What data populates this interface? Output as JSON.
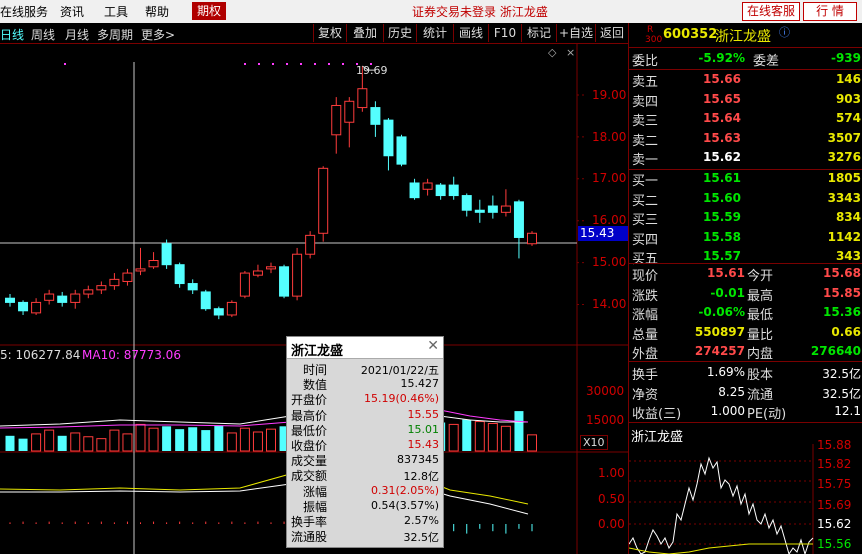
{
  "menubar": {
    "items": [
      "在线服务",
      "资讯",
      "工具",
      "帮助"
    ],
    "options_tab": "期权",
    "status_text": "证券交易未登录  浙江龙盛",
    "online_service_button": "在线客服",
    "quote_button": "行 情"
  },
  "toolbar": {
    "periods": [
      "日线",
      "周线",
      "月线",
      "多周期",
      "更多>"
    ],
    "buttons": [
      "复权",
      "叠加",
      "历史",
      "统计",
      "画线",
      "F10",
      "标记",
      "+自选",
      "返回"
    ]
  },
  "chart": {
    "max_price_label": "19.69",
    "crosshair_price": "15.43",
    "price_axis": [
      "19.00",
      "18.00",
      "17.00",
      "16.00",
      "15.00",
      "14.00"
    ],
    "vol_ma_text": "5: 106277.84",
    "vol_ma10_text": "MA10: 87773.06",
    "vol_axis": [
      "30000",
      "15000"
    ],
    "vol_unit": "X10",
    "macd_axis": [
      "1.00",
      "0.50",
      "0.00"
    ]
  },
  "chart_data": {
    "type": "candlestick",
    "up_color": "#ff3c3c",
    "down_color": "#54ffff",
    "candles": [
      {
        "o": 14.15,
        "c": 14.05,
        "h": 14.25,
        "l": 13.95
      },
      {
        "o": 14.05,
        "c": 13.85,
        "h": 14.1,
        "l": 13.75
      },
      {
        "o": 13.8,
        "c": 14.05,
        "h": 14.15,
        "l": 13.75
      },
      {
        "o": 14.1,
        "c": 14.25,
        "h": 14.35,
        "l": 14.0
      },
      {
        "o": 14.2,
        "c": 14.05,
        "h": 14.3,
        "l": 13.95
      },
      {
        "o": 14.05,
        "c": 14.25,
        "h": 14.35,
        "l": 13.9
      },
      {
        "o": 14.25,
        "c": 14.35,
        "h": 14.45,
        "l": 14.15
      },
      {
        "o": 14.35,
        "c": 14.45,
        "h": 14.55,
        "l": 14.25
      },
      {
        "o": 14.45,
        "c": 14.6,
        "h": 14.75,
        "l": 14.35
      },
      {
        "o": 14.55,
        "c": 14.75,
        "h": 14.85,
        "l": 14.45
      },
      {
        "o": 14.8,
        "c": 14.85,
        "h": 15.35,
        "l": 14.7
      },
      {
        "o": 14.9,
        "c": 15.05,
        "h": 15.25,
        "l": 14.85
      },
      {
        "o": 15.45,
        "c": 14.95,
        "h": 15.55,
        "l": 14.85
      },
      {
        "o": 14.95,
        "c": 14.5,
        "h": 15.0,
        "l": 14.4
      },
      {
        "o": 14.5,
        "c": 14.35,
        "h": 14.6,
        "l": 14.25
      },
      {
        "o": 14.3,
        "c": 13.9,
        "h": 14.35,
        "l": 13.85
      },
      {
        "o": 13.9,
        "c": 13.75,
        "h": 13.95,
        "l": 13.65
      },
      {
        "o": 13.75,
        "c": 14.05,
        "h": 14.1,
        "l": 13.7
      },
      {
        "o": 14.2,
        "c": 14.75,
        "h": 14.8,
        "l": 14.15
      },
      {
        "o": 14.7,
        "c": 14.8,
        "h": 14.95,
        "l": 14.65
      },
      {
        "o": 14.85,
        "c": 14.9,
        "h": 15.0,
        "l": 14.75
      },
      {
        "o": 14.9,
        "c": 14.2,
        "h": 14.95,
        "l": 14.15
      },
      {
        "o": 14.2,
        "c": 15.2,
        "h": 15.35,
        "l": 14.1
      },
      {
        "o": 15.2,
        "c": 15.65,
        "h": 15.75,
        "l": 15.1
      },
      {
        "o": 15.7,
        "c": 17.25,
        "h": 17.3,
        "l": 15.5
      },
      {
        "o": 18.05,
        "c": 18.75,
        "h": 18.95,
        "l": 17.6
      },
      {
        "o": 18.35,
        "c": 18.85,
        "h": 18.95,
        "l": 17.75
      },
      {
        "o": 18.7,
        "c": 19.15,
        "h": 19.69,
        "l": 18.6
      },
      {
        "o": 18.7,
        "c": 18.3,
        "h": 18.85,
        "l": 18.0
      },
      {
        "o": 18.4,
        "c": 17.55,
        "h": 18.45,
        "l": 17.2
      },
      {
        "o": 18.0,
        "c": 17.35,
        "h": 18.05,
        "l": 17.3
      },
      {
        "o": 16.9,
        "c": 16.55,
        "h": 17.0,
        "l": 16.5
      },
      {
        "o": 16.75,
        "c": 16.9,
        "h": 17.0,
        "l": 16.6
      },
      {
        "o": 16.85,
        "c": 16.6,
        "h": 16.9,
        "l": 16.5
      },
      {
        "o": 16.85,
        "c": 16.6,
        "h": 17.05,
        "l": 16.5
      },
      {
        "o": 16.6,
        "c": 16.25,
        "h": 16.65,
        "l": 16.1
      },
      {
        "o": 16.25,
        "c": 16.2,
        "h": 16.5,
        "l": 15.95
      },
      {
        "o": 16.35,
        "c": 16.2,
        "h": 16.6,
        "l": 16.05
      },
      {
        "o": 16.2,
        "c": 16.35,
        "h": 16.75,
        "l": 16.1
      },
      {
        "o": 16.45,
        "c": 15.6,
        "h": 16.5,
        "l": 15.1
      },
      {
        "o": 15.45,
        "c": 15.7,
        "h": 15.75,
        "l": 15.4
      }
    ],
    "volume": [
      {
        "v": 8000,
        "up": false
      },
      {
        "v": 6500,
        "up": false
      },
      {
        "v": 9000,
        "up": true
      },
      {
        "v": 11000,
        "up": true
      },
      {
        "v": 8000,
        "up": false
      },
      {
        "v": 9500,
        "up": true
      },
      {
        "v": 7500,
        "up": true
      },
      {
        "v": 6500,
        "up": true
      },
      {
        "v": 11000,
        "up": true
      },
      {
        "v": 9000,
        "up": true
      },
      {
        "v": 14000,
        "up": true
      },
      {
        "v": 12000,
        "up": true
      },
      {
        "v": 13000,
        "up": false
      },
      {
        "v": 11500,
        "up": false
      },
      {
        "v": 12500,
        "up": false
      },
      {
        "v": 11000,
        "up": false
      },
      {
        "v": 13500,
        "up": false
      },
      {
        "v": 9500,
        "up": true
      },
      {
        "v": 12000,
        "up": true
      },
      {
        "v": 10000,
        "up": true
      },
      {
        "v": 11500,
        "up": true
      },
      {
        "v": 13000,
        "up": false
      },
      {
        "v": 15000,
        "up": true
      },
      {
        "v": 16000,
        "up": true
      },
      {
        "v": 27000,
        "up": true
      },
      {
        "v": 31000,
        "up": true
      },
      {
        "v": 29000,
        "up": true
      },
      {
        "v": 27000,
        "up": false
      },
      {
        "v": 30000,
        "up": false
      },
      {
        "v": 25000,
        "up": false
      },
      {
        "v": 20000,
        "up": false
      },
      {
        "v": 19000,
        "up": false
      },
      {
        "v": 14500,
        "up": true
      },
      {
        "v": 15000,
        "up": false
      },
      {
        "v": 14000,
        "up": true
      },
      {
        "v": 16500,
        "up": false
      },
      {
        "v": 15500,
        "up": true
      },
      {
        "v": 14500,
        "up": true
      },
      {
        "v": 13000,
        "up": true
      },
      {
        "v": 21000,
        "up": false
      },
      {
        "v": 8500,
        "up": true
      }
    ]
  },
  "quote": {
    "code": "600352",
    "name": "浙江龙盛",
    "r_tag": "R",
    "index_tag": "300",
    "webi_label": "委比",
    "webi_value": "-5.92%",
    "weicha_label": "委差",
    "weicha_value": "-939",
    "asks": [
      {
        "label": "卖五",
        "price": "15.66",
        "vol": "146"
      },
      {
        "label": "卖四",
        "price": "15.65",
        "vol": "903"
      },
      {
        "label": "卖三",
        "price": "15.64",
        "vol": "574"
      },
      {
        "label": "卖二",
        "price": "15.63",
        "vol": "3507"
      },
      {
        "label": "卖一",
        "price": "15.62",
        "vol": "3276"
      }
    ],
    "bids": [
      {
        "label": "买一",
        "price": "15.61",
        "vol": "1805"
      },
      {
        "label": "买二",
        "price": "15.60",
        "vol": "3343"
      },
      {
        "label": "买三",
        "price": "15.59",
        "vol": "834"
      },
      {
        "label": "买四",
        "price": "15.58",
        "vol": "1142"
      },
      {
        "label": "买五",
        "price": "15.57",
        "vol": "343"
      }
    ],
    "stats": [
      {
        "l1": "现价",
        "v1": "15.61",
        "l2": "今开",
        "v2": "15.68"
      },
      {
        "l1": "涨跌",
        "v1": "-0.01",
        "l2": "最高",
        "v2": "15.85"
      },
      {
        "l1": "涨幅",
        "v1": "-0.06%",
        "l2": "最低",
        "v2": "15.36"
      },
      {
        "l1": "总量",
        "v1": "550897",
        "l2": "量比",
        "v2": "0.66"
      },
      {
        "l1": "外盘",
        "v1": "274257",
        "l2": "内盘",
        "v2": "276640"
      }
    ],
    "stats2": [
      {
        "l1": "换手",
        "v1": "1.69%",
        "l2": "股本",
        "v2": "32.5亿"
      },
      {
        "l1": "净资",
        "v1": "8.25",
        "l2": "流通",
        "v2": "32.5亿"
      },
      {
        "l1": "收益(三)",
        "v1": "1.000",
        "l2": "PE(动)",
        "v2": "12.1"
      }
    ],
    "mini_chart_title": "浙江龙盛",
    "mini_axis": [
      "15.88",
      "15.82",
      "15.75",
      "15.69",
      "15.62",
      "15.56"
    ]
  },
  "popup": {
    "title": "浙江龙盛",
    "rows": [
      {
        "label": "时间",
        "value": "2021/01/22/五",
        "color": "#000"
      },
      {
        "label": "数值",
        "value": "15.427",
        "color": "#000"
      },
      {
        "label": "开盘价",
        "value": "15.19(0.46%)",
        "color": "#d00000"
      },
      {
        "label": "最高价",
        "value": "15.55",
        "color": "#d00000"
      },
      {
        "label": "最低价",
        "value": "15.01",
        "color": "#008000"
      },
      {
        "label": "收盘价",
        "value": "15.43",
        "color": "#d00000"
      },
      {
        "label": "成交量",
        "value": "837345",
        "color": "#000"
      },
      {
        "label": "成交额",
        "value": "12.8亿",
        "color": "#000"
      },
      {
        "label": "涨幅",
        "value": "0.31(2.05%)",
        "color": "#d00000"
      },
      {
        "label": "振幅",
        "value": "0.54(3.57%)",
        "color": "#000"
      },
      {
        "label": "换手率",
        "value": "2.57%",
        "color": "#000"
      },
      {
        "label": "流通股",
        "value": "32.5亿",
        "color": "#000"
      }
    ]
  }
}
